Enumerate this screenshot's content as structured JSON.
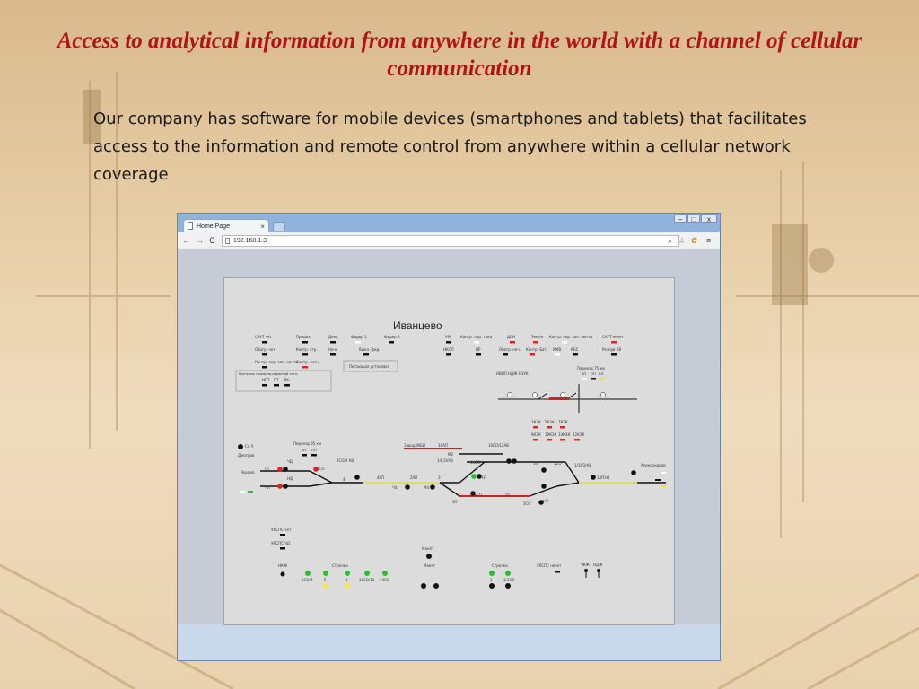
{
  "slide": {
    "title": "Access to analytical information from anywhere in the world with a channel of cellular communication",
    "body": "Our company has software for mobile devices (smartphones and tablets) that facilitates access to the information and remote control from anywhere within a cellular network coverage"
  },
  "browser": {
    "tab_title": "Home Page",
    "tab_close": "×",
    "window_controls": [
      "–",
      "□",
      "x"
    ],
    "address": "192.168.1.3"
  },
  "scheme": {
    "station_name": "Иванцево",
    "top_labels_row1": [
      "САУТ чет",
      "Предох",
      "День",
      "Фидер 1",
      "Фидер 2",
      "УМ",
      "Контр. пер. тока",
      "ДСН",
      "Земля",
      "Контр. пер. зап. ленты",
      "САУТ нечет"
    ],
    "top_labels_row2": [
      "Обогр. чет.",
      "Контр. стр.",
      "Ночь",
      "Выкл. фид.",
      "НКСЛ",
      "ИР",
      "Обогр. неч.",
      "Контр. Бат.",
      "ИМВ",
      "КБС",
      "Резерв КВ"
    ],
    "top_labels_row3": [
      "Контр. пер. зап. ленты",
      "Контр. сигн."
    ],
    "fire_panel": "Контроль пожарно-охранной сигн.",
    "fire_items": [
      "НПТ",
      "ПТ",
      "ВС"
    ],
    "power_unit": "Питающая установка",
    "crossing_75": "Переезд 75 км",
    "crossing_75_items": [
      "ЗП",
      "ОП",
      "БП"
    ],
    "nvip": "НВИП НДЖ Н1УК",
    "indicators_mid": [
      "ЗКЗК",
      "5КЗК",
      "7КЗК",
      "9КЗК",
      "10КЗК",
      "14КЗК",
      "12КЗК"
    ],
    "crossing_95": "Переезд 95 км",
    "crossing_95_items": [
      "ЗП",
      "ОП"
    ],
    "left_station": "Дмитров",
    "left_station_side": "Сп.Ч",
    "yakrom": "Яхрома",
    "right_station": "Александров",
    "track_labels": [
      "2СО/4 АВ",
      "2СО",
      "ЧД",
      "НД",
      "ЧП",
      "Ч1",
      "4АП",
      "2АП",
      "3",
      "4",
      "5",
      "Ч4",
      "М4",
      "10АП",
      "10СО/12АВ",
      "Завод ЖБИ",
      "14СО/АВ",
      "М2",
      "14СО",
      "12",
      "1П",
      "1СО",
      "1/1СО/АВ",
      "Н3",
      "Н1",
      "1АП",
      "Н2",
      "7БСО",
      "3П",
      "Ч2",
      "5СО",
      "НЧ",
      "Ч3"
    ],
    "ukspc": [
      "УКСПС чет",
      "УКСПС ЧД",
      "УКСПС нечет"
    ],
    "bottom_groups": [
      "НКЖ",
      "Стрелки",
      "Макет",
      "Стрелки",
      "ЧКЖ",
      "НДЖ"
    ],
    "switches_left": [
      "2СО/4",
      "5",
      "8",
      "10СО/12",
      "14СО"
    ],
    "switches_right": [
      "3",
      "1/1СО"
    ],
    "manek": "Манёт"
  },
  "colors": {
    "title_red": "#b0141a",
    "track_yellow": "#e8e13a",
    "track_red": "#d42222",
    "lamp_green": "#27c227",
    "lamp_yellow": "#f2e84a",
    "lamp_red": "#e22222"
  }
}
